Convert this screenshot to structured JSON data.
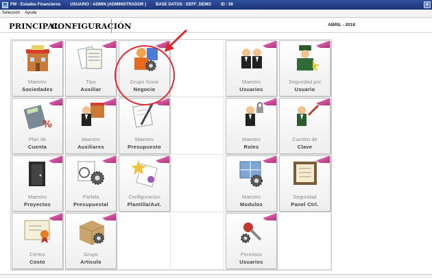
{
  "titlebar": {
    "app": "FW - Estados Financieros",
    "user": "USUARIO : ADMIN (ADMINISTRADOR )",
    "database": "BASE DATOS : EEFF_DEMO",
    "id": "ID : 56",
    "close_glyph": "x"
  },
  "menu": {
    "items": [
      "Selección",
      "Ayuda"
    ]
  },
  "tabs": {
    "principal": "PRINCIPAL",
    "config": "CONFIGURACIÓN"
  },
  "period": "ABRIL - 2018",
  "tiles": [
    {
      "l1": "Maestro",
      "l2": "Sociedades",
      "icon": "building-icon"
    },
    {
      "l1": "Tipo",
      "l2": "Auxiliar",
      "icon": "documents-icon"
    },
    {
      "l1": "Grupo Socio",
      "l2": "Negocio",
      "icon": "business-partner-icon"
    },
    null,
    {
      "l1": "Maestro",
      "l2": "Usuarios",
      "icon": "users-icon"
    },
    {
      "l1": "Seguridad por",
      "l2": "Usuario",
      "icon": "security-guard-icon"
    },
    {
      "l1": "Plan de",
      "l2": "Cuenta",
      "icon": "calculator-icon"
    },
    {
      "l1": "Maestro",
      "l2": "Auxiliares",
      "icon": "employee-building-icon"
    },
    {
      "l1": "Maestro",
      "l2": "Presupuesto",
      "icon": "budget-pen-icon"
    },
    null,
    {
      "l1": "Maestro",
      "l2": "Roles",
      "icon": "user-lock-icon"
    },
    {
      "l1": "Cambio de",
      "l2": "Clave",
      "icon": "change-password-icon"
    },
    {
      "l1": "Maestro",
      "l2": "Proyectos",
      "icon": "project-door-icon"
    },
    {
      "l1": "Partida",
      "l2": "Presupuestal",
      "icon": "budget-gears-icon"
    },
    {
      "l1": "Configuracion",
      "l2": "Plantilla/Aut.",
      "icon": "template-star-icon"
    },
    null,
    {
      "l1": "Maestro",
      "l2": "Modulos",
      "icon": "modules-gear-icon"
    },
    {
      "l1": "Seguridad",
      "l2": "Panel Ctrl.",
      "icon": "control-panel-book-icon"
    },
    {
      "l1": "Centro",
      "l2": "Costo",
      "icon": "cost-center-certificate-icon"
    },
    {
      "l1": "Grupo",
      "l2": "Articulo",
      "icon": "box-gears-icon"
    },
    null,
    null,
    {
      "l1": "Permisos",
      "l2": "Usuarios",
      "icon": "permissions-keys-icon"
    },
    null
  ],
  "colors": {
    "accent_corner": "#c51a86",
    "highlight": "#e0262c",
    "titlebar": "#1c3578"
  }
}
